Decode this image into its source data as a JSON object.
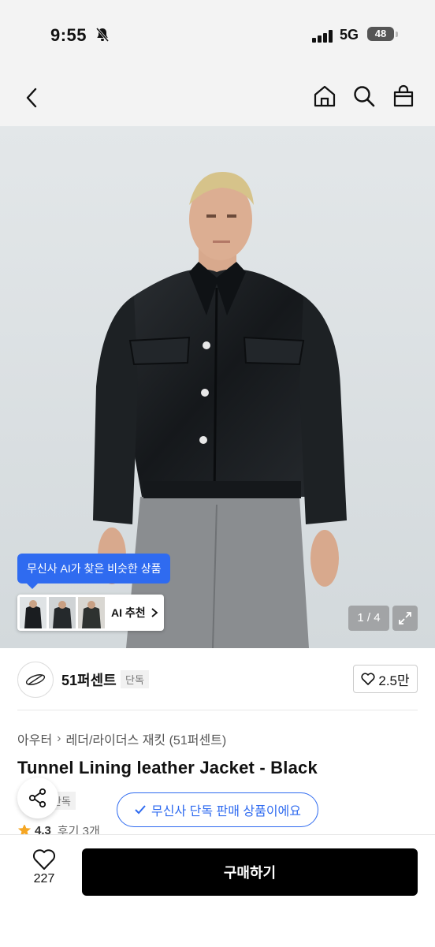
{
  "status_bar": {
    "time": "9:55",
    "network": "5G",
    "battery": "48"
  },
  "hero": {
    "ai_tooltip": "무신사 AI가 찾은 비슷한 상품",
    "ai_recommend_label": "AI 추천",
    "pager": "1 / 4"
  },
  "brand": {
    "name": "51퍼센트",
    "badge": "단독",
    "likes": "2.5만"
  },
  "product": {
    "category_parent": "아우터",
    "category_child": "레더/라이더스 재킷 (51퍼센트)",
    "title": "Tunnel Lining leather Jacket - Black",
    "tag": "단독",
    "exclusive_notice": "무신사 단독 판매 상품이에요",
    "rating": "4.3",
    "reviews": "후기 3개"
  },
  "bottom_bar": {
    "like_count": "227",
    "buy_label": "구매하기"
  },
  "colors": {
    "accent": "#2f6bf0",
    "buy_button": "#000000",
    "star": "#f5a623"
  }
}
